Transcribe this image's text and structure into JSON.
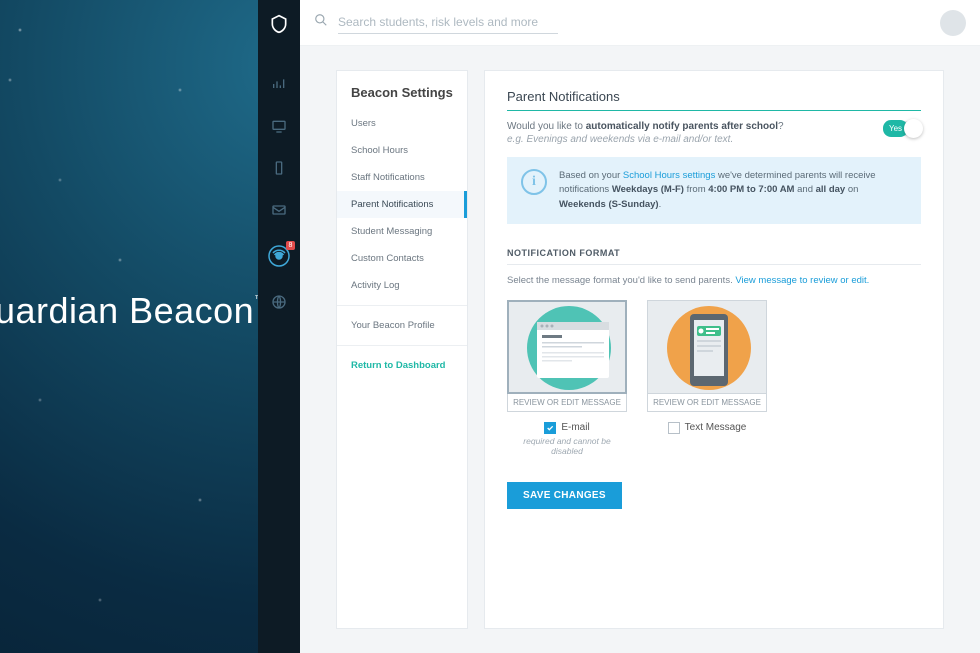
{
  "brand": {
    "name_fragment": "uardian Beacon",
    "tm": "™"
  },
  "search": {
    "placeholder": "Search students, risk levels and more"
  },
  "rail": {
    "items": [
      {
        "name": "dashboard-icon"
      },
      {
        "name": "monitor-icon"
      },
      {
        "name": "device-icon"
      },
      {
        "name": "mail-icon"
      },
      {
        "name": "beacon-icon",
        "badge": "8"
      },
      {
        "name": "globe-icon"
      }
    ]
  },
  "settings": {
    "title": "Beacon Settings",
    "items": [
      {
        "label": "Users",
        "active": false
      },
      {
        "label": "School Hours",
        "active": false
      },
      {
        "label": "Staff Notifications",
        "active": false
      },
      {
        "label": "Parent Notifications",
        "active": true
      },
      {
        "label": "Student Messaging",
        "active": false
      },
      {
        "label": "Custom Contacts",
        "active": false
      },
      {
        "label": "Activity Log",
        "active": false
      }
    ],
    "profile_label": "Your Beacon Profile",
    "return_label": "Return to Dashboard"
  },
  "panel": {
    "title": "Parent Notifications",
    "prompt_prefix": "Would you like to ",
    "prompt_bold": "automatically notify parents after school",
    "prompt_suffix": "?",
    "prompt_example": "e.g. Evenings and weekends via e-mail and/or text.",
    "toggle_on_label": "Yes",
    "info": {
      "pre": "Based on your ",
      "link": "School Hours settings",
      "mid1": " we've determined parents will receive notifications ",
      "b1": "Weekdays (M-F)",
      "mid2": " from ",
      "b2": "4:00 PM to 7:00 AM",
      "mid3": " and ",
      "b3": "all day",
      "mid4": " on ",
      "b4": "Weekends (S-Sunday)",
      "tail": "."
    },
    "format_section": "NOTIFICATION FORMAT",
    "format_desc": "Select the message format you'd like to send parents. ",
    "format_link": "View message to review or edit.",
    "cards": {
      "email": {
        "caption": "REVIEW OR EDIT MESSAGE",
        "label": "E-mail",
        "hint": "required and cannot be disabled",
        "checked": true
      },
      "text": {
        "caption": "REVIEW OR EDIT MESSAGE",
        "label": "Text Message",
        "checked": false
      }
    },
    "save_label": "SAVE CHANGES"
  }
}
